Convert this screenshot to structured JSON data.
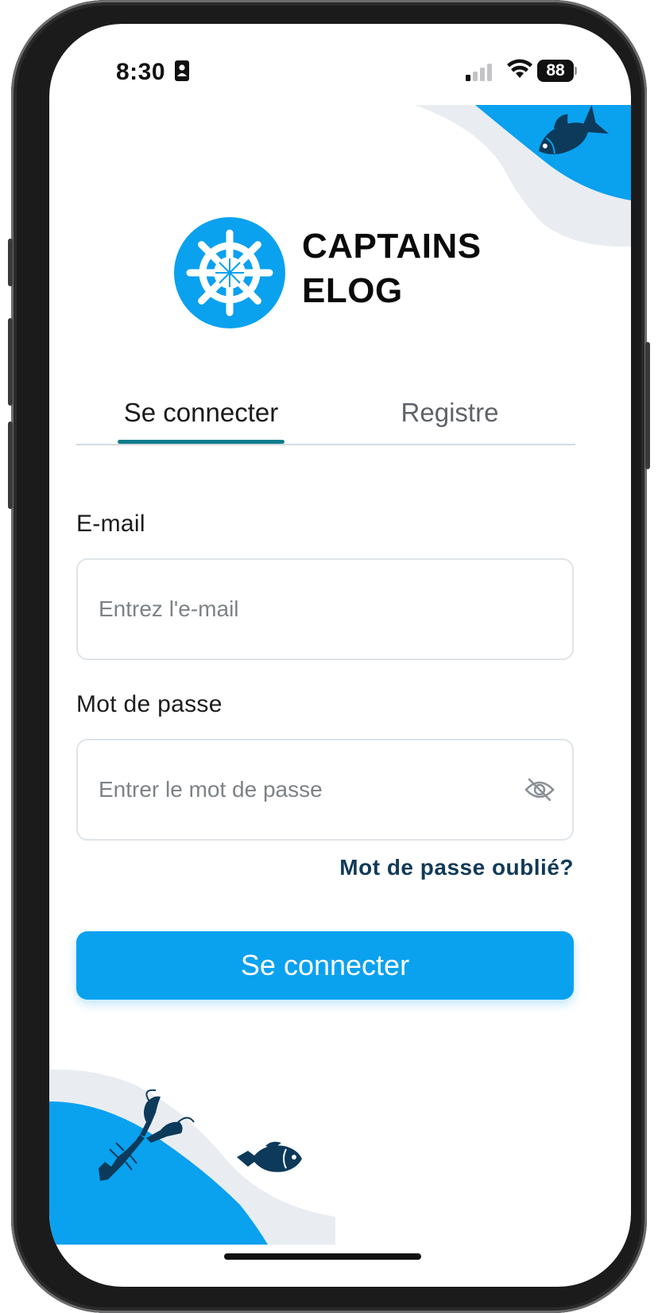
{
  "status_bar": {
    "time": "8:30",
    "battery": "88",
    "icons": [
      "id-card-icon",
      "cellular-signal-icon",
      "wifi-icon",
      "battery-icon"
    ]
  },
  "brand": {
    "logo_icon": "ship-wheel-icon",
    "name_line1": "CAPTAINS",
    "name_line2": "ELOG"
  },
  "tabs": [
    {
      "label": "Se connecter",
      "active": true
    },
    {
      "label": "Registre",
      "active": false
    }
  ],
  "form": {
    "email_label": "E-mail",
    "email_placeholder": "Entrez l'e-mail",
    "email_value": "",
    "password_label": "Mot de passe",
    "password_placeholder": "Entrer le mot de passe",
    "password_value": "",
    "password_toggle_icon": "eye-slash-icon",
    "forgot_link": "Mot de passe oublié?",
    "submit_label": "Se connecter"
  },
  "decorations": [
    "fish-icon",
    "lobster-icon",
    "fish-icon"
  ],
  "colors": {
    "primary": "#0aa1ef",
    "tab_indicator": "#0f7c8c",
    "link": "#113a58",
    "deco_dark": "#0d3a5a",
    "deco_light": "#e9edf1"
  }
}
